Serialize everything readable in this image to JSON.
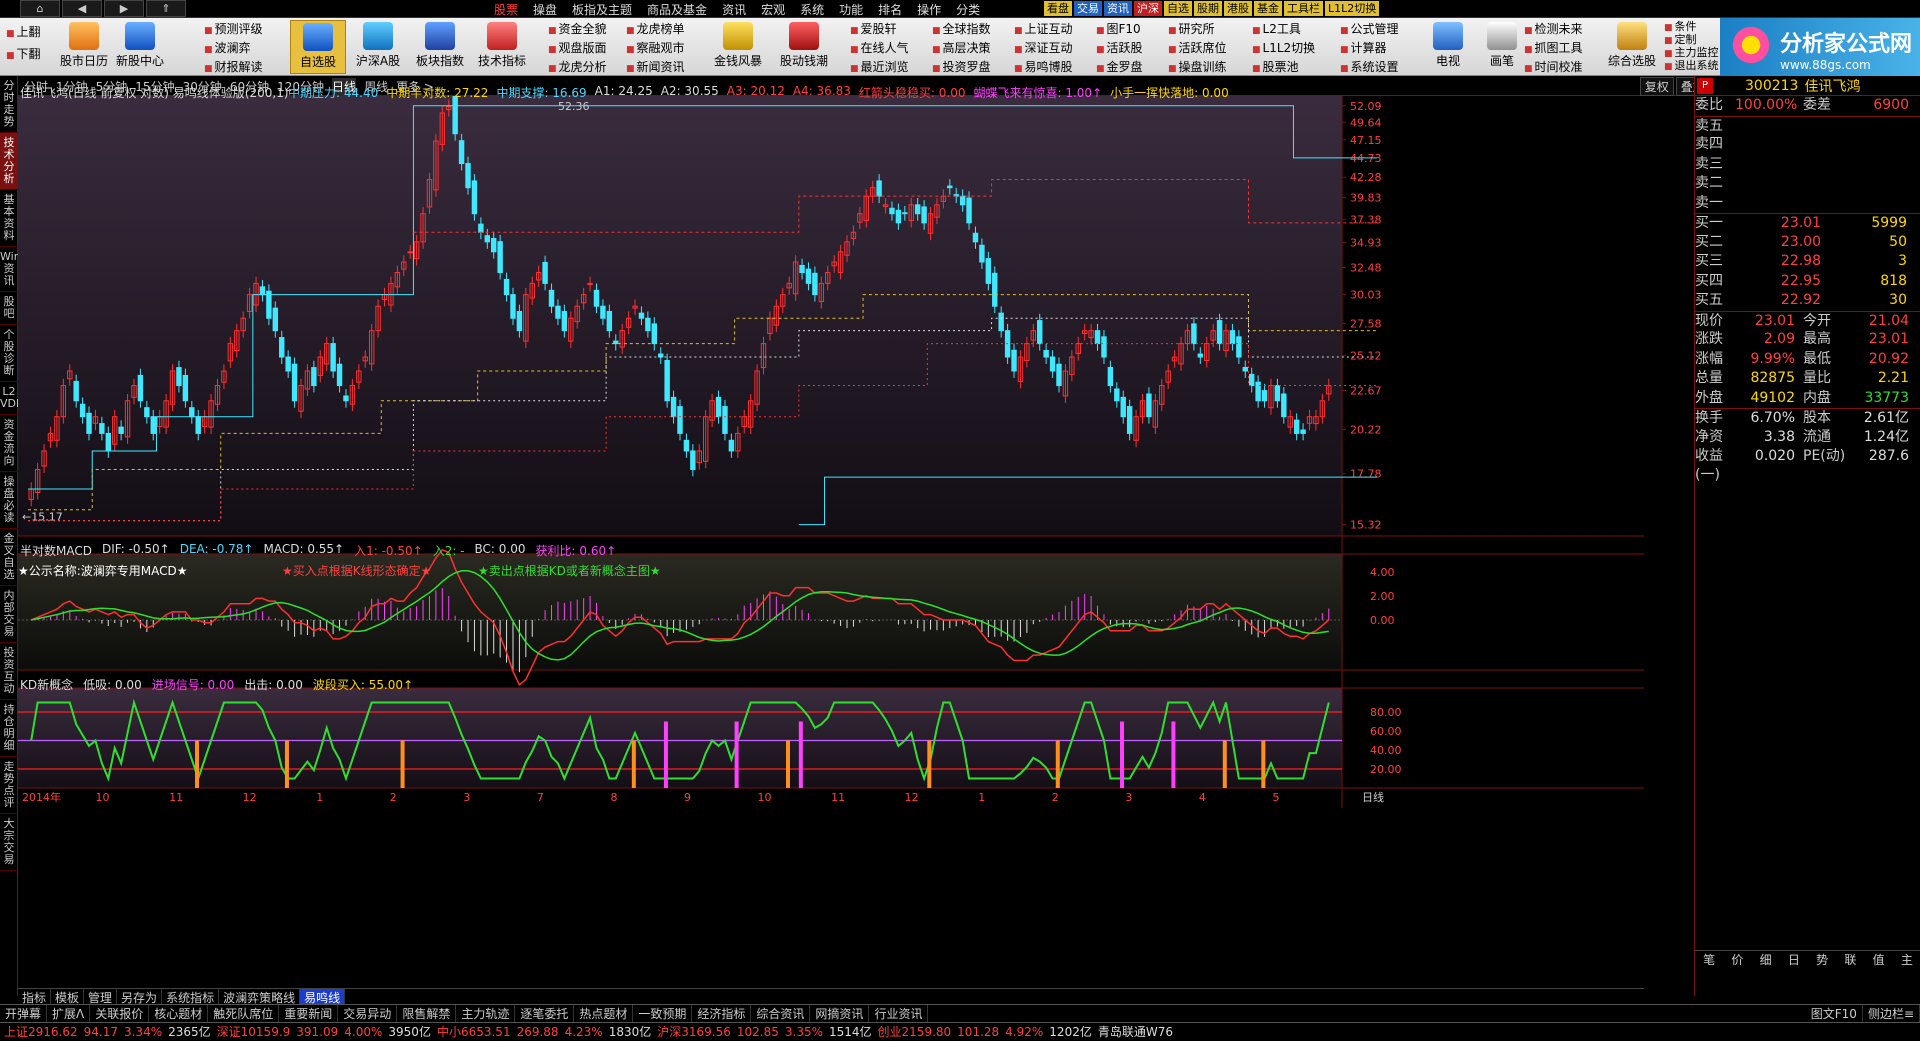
{
  "menu": {
    "nav": [
      "上",
      "上",
      "下",
      "下"
    ],
    "items": [
      "股票",
      "操盘",
      "板指及主题",
      "商品及基金",
      "资讯",
      "宏观",
      "系统",
      "功能",
      "排名",
      "操作",
      "分类"
    ],
    "tags": [
      "看盘",
      "交易",
      "资讯",
      "沪深",
      "自选",
      "股期",
      "港股",
      "基金",
      "工具栏",
      "L1L2切换"
    ]
  },
  "toolbar": {
    "buttons": [
      "股市日历",
      "新股中心",
      "自选股",
      "沪深A股",
      "板块指数",
      "技术指标",
      "金钱风暴",
      "股动钱潮",
      "电视",
      "画笔",
      "综合选股"
    ],
    "col1": [
      "上翻",
      "下翻"
    ],
    "col2": [
      "预测评级",
      "波澜弈",
      "财报解读"
    ],
    "col3": [
      "资金全貌",
      "观盘版面",
      "龙虎分析"
    ],
    "col4": [
      "龙虎榜单",
      "察融观市",
      "新闻资讯"
    ],
    "col5": [
      "爱股轩",
      "在线人气",
      "最近浏览"
    ],
    "col6": [
      "全球指数",
      "高层决策",
      "投资罗盘"
    ],
    "col7": [
      "上证互动",
      "深证互动",
      "易鸣博股"
    ],
    "col8": [
      "图F10",
      "活跃股",
      "金罗盘"
    ],
    "col9": [
      "研究所",
      "活跃席位",
      "操盘训练"
    ],
    "col10": [
      "L2工具",
      "L1L2切换",
      "股票池"
    ],
    "col11": [
      "公式管理",
      "计算器",
      "系统设置"
    ],
    "col12": [
      "检测未来",
      "抓图工具",
      "时间校准"
    ],
    "col13": [
      "条件",
      "定制",
      "主力监控",
      "退出系统"
    ],
    "logo": "分析家公式网",
    "logo_url": "www.88gs.com"
  },
  "periods": [
    "分时",
    "1分钟",
    "5分钟",
    "15分钟",
    "30分钟",
    "60分钟",
    "120分钟",
    "日线",
    "周线",
    "更多 >"
  ],
  "period_right": [
    "复权",
    "叠加",
    "画线",
    "F10",
    "标记",
    "+自选",
    "返回"
  ],
  "left_tabs": [
    "分时走势",
    "技术分析",
    "基本资料",
    "Wind资讯",
    "股吧",
    "个股诊断",
    "L2 VDE",
    "资金流向",
    "操盘必读",
    "金叉自选",
    "内部交易",
    "投资互动",
    "持仓明细",
    "走势点评",
    "大宗交易"
  ],
  "main": {
    "title": "佳讯飞鸿(日线 前复权 对数) 易鸣线体验版(200,1)",
    "ind": [
      {
        "t": "中期压力: 44.40",
        "c": "c"
      },
      {
        "t": "中期半对数: 27.22",
        "c": "y"
      },
      {
        "t": "中期支撑: 16.69",
        "c": "c"
      },
      {
        "t": "A1: 24.25",
        "c": "w"
      },
      {
        "t": "A2: 30.55",
        "c": "w"
      },
      {
        "t": "A3: 20.12",
        "c": "r"
      },
      {
        "t": "A4: 36.83",
        "c": "r"
      },
      {
        "t": "红箭头稳稳买: 0.00",
        "c": "r"
      },
      {
        "t": "蝴蝶飞来有惊喜: 1.00↑",
        "c": "m"
      },
      {
        "t": "小手一挥快落地: 0.00",
        "c": "y"
      }
    ],
    "yaxis": [
      "52.09",
      "49.64",
      "47.15",
      "44.73",
      "42.28",
      "39.83",
      "37.38",
      "34.93",
      "32.48",
      "30.03",
      "27.58",
      "25.12",
      "22.67",
      "20.22",
      "17.78",
      "15.32"
    ],
    "high_label": "52.36",
    "low_label": "←15.17"
  },
  "macd": {
    "header": [
      {
        "t": "半对数MACD",
        "c": "w"
      },
      {
        "t": "DIF: -0.50↑",
        "c": "w"
      },
      {
        "t": "DEA: -0.78↑",
        "c": "c"
      },
      {
        "t": "MACD: 0.55↑",
        "c": "w"
      },
      {
        "t": "入1: -0.50↑",
        "c": "r"
      },
      {
        "t": "入2: -",
        "c": "g"
      },
      {
        "t": "BC: 0.00",
        "c": "w"
      },
      {
        "t": "获利比: 0.60↑",
        "c": "m"
      }
    ],
    "caption1": "★公示名称:波澜弈专用MACD★",
    "caption2": "★买入点根据K线形态确定★",
    "caption3": "★卖出点根据KD或者新概念主图★",
    "yaxis": [
      "4.00",
      "2.00",
      "0.00"
    ]
  },
  "kd": {
    "header": [
      {
        "t": "KD新概念",
        "c": "w"
      },
      {
        "t": "低吸: 0.00",
        "c": "w"
      },
      {
        "t": "进场信号: 0.00",
        "c": "m"
      },
      {
        "t": "出击: 0.00",
        "c": "w"
      },
      {
        "t": "波段买入: 55.00↑",
        "c": "y"
      }
    ],
    "yaxis": [
      "80.00",
      "60.00",
      "40.00",
      "20.00"
    ]
  },
  "xaxis": [
    "2014年",
    "10",
    "11",
    "12",
    "1",
    "2",
    "3",
    "7",
    "8",
    "9",
    "10",
    "11",
    "12",
    "1",
    "2",
    "3",
    "4",
    "5"
  ],
  "xaxis_right": "日线",
  "subtabs": [
    "指标",
    "模板",
    "管理",
    "另存为",
    "系统指标",
    "波澜弈策略线",
    "易鸣线"
  ],
  "bottom_tabs": [
    "开弹幕",
    "扩展ᐱ",
    "关联报价",
    "核心题材",
    "触死队席位",
    "重要新闻",
    "交易异动",
    "限售解禁",
    "主力轨迹",
    "逐笔委托",
    "热点题材",
    "一致预期",
    "经济指标",
    "综合资讯",
    "网摘资讯",
    "行业资讯"
  ],
  "bottom_right": [
    "图文F10",
    "侧边栏≡"
  ],
  "right_panel": {
    "code": "300213",
    "name": "佳讯飞鸿",
    "ratio": [
      "委比",
      "100.00%",
      "委差",
      "6900"
    ],
    "sells": [
      "卖五",
      "卖四",
      "卖三",
      "卖二",
      "卖一"
    ],
    "buys": [
      [
        "买一",
        "23.01",
        "5999"
      ],
      [
        "买二",
        "23.00",
        "50"
      ],
      [
        "买三",
        "22.98",
        "3"
      ],
      [
        "买四",
        "22.95",
        "818"
      ],
      [
        "买五",
        "22.92",
        "30"
      ]
    ],
    "stats": [
      [
        "现价",
        "23.01",
        "今开",
        "21.04"
      ],
      [
        "涨跌",
        "2.09",
        "最高",
        "23.01"
      ],
      [
        "涨幅",
        "9.99%",
        "最低",
        "20.92"
      ],
      [
        "总量",
        "82875",
        "量比",
        "2.21"
      ],
      [
        "外盘",
        "49102",
        "内盘",
        "33773"
      ]
    ],
    "stats2": [
      [
        "换手",
        "6.70%",
        "股本",
        "2.61亿"
      ],
      [
        "净资",
        "3.38",
        "流通",
        "1.24亿"
      ],
      [
        "收益(一)",
        "0.020",
        "PE(动)",
        "287.6"
      ]
    ],
    "tabs": [
      "笔",
      "价",
      "细",
      "日",
      "势",
      "联",
      "值",
      "主"
    ]
  },
  "status": [
    {
      "t": "上证2916.62",
      "c": "r"
    },
    {
      "t": "94.17",
      "c": "r"
    },
    {
      "t": "3.34%",
      "c": "r"
    },
    {
      "t": "2365亿",
      "c": "w"
    },
    {
      "t": "深证10159.9",
      "c": "r"
    },
    {
      "t": "391.09",
      "c": "r"
    },
    {
      "t": "4.00%",
      "c": "r"
    },
    {
      "t": "3950亿",
      "c": "w"
    },
    {
      "t": "中小6653.51",
      "c": "r"
    },
    {
      "t": "269.88",
      "c": "r"
    },
    {
      "t": "4.23%",
      "c": "r"
    },
    {
      "t": "1830亿",
      "c": "w"
    },
    {
      "t": "沪深3169.56",
      "c": "r"
    },
    {
      "t": "102.85",
      "c": "r"
    },
    {
      "t": "3.35%",
      "c": "r"
    },
    {
      "t": "1514亿",
      "c": "w"
    },
    {
      "t": "创业2159.80",
      "c": "r"
    },
    {
      "t": "101.28",
      "c": "r"
    },
    {
      "t": "4.92%",
      "c": "r"
    },
    {
      "t": "1202亿",
      "c": "w"
    },
    {
      "t": "青岛联通W76",
      "c": "w"
    }
  ],
  "chart_data": {
    "type": "candlestick",
    "ylim": [
      15.17,
      52.36
    ],
    "closes": [
      17,
      18,
      19,
      20,
      21,
      23,
      24,
      22,
      21,
      20,
      21,
      20,
      19,
      21,
      20,
      22,
      23,
      22,
      21,
      20,
      21,
      22,
      24,
      23,
      22,
      21,
      20,
      21,
      22,
      23,
      24,
      26,
      27,
      28,
      30,
      31,
      30,
      28,
      27,
      25,
      24,
      22,
      23,
      24,
      23,
      25,
      26,
      24,
      23,
      22,
      23,
      24,
      25,
      27,
      29,
      30,
      31,
      32,
      33,
      34,
      35,
      38,
      42,
      47,
      51,
      52,
      48,
      44,
      41,
      38,
      36,
      35,
      34,
      32,
      30,
      28,
      27,
      30,
      31,
      32,
      31,
      29,
      28,
      27,
      28,
      29,
      30,
      31,
      29,
      28,
      27,
      26,
      27,
      28,
      29,
      28,
      27,
      26,
      25,
      22,
      21,
      20,
      19,
      18,
      19,
      21,
      22,
      21,
      20,
      19,
      20,
      21,
      22,
      24,
      26,
      28,
      29,
      30,
      31,
      33,
      32,
      31,
      30,
      31,
      32,
      33,
      34,
      35,
      36,
      38,
      40,
      41,
      40,
      39,
      38,
      37,
      38,
      39,
      38,
      37,
      38,
      39,
      40,
      41,
      40,
      39,
      37,
      35,
      33,
      31,
      29,
      27,
      25,
      24,
      25,
      26,
      27,
      26,
      25,
      24,
      23,
      24,
      25,
      26,
      27,
      27,
      26,
      25,
      23,
      22,
      21,
      20,
      21,
      22,
      21,
      22,
      23,
      24,
      25,
      26,
      27,
      26,
      25,
      26,
      27,
      26,
      27,
      26,
      25,
      24,
      23,
      22,
      22,
      23,
      22,
      21,
      21,
      20,
      20,
      21,
      21,
      22,
      23
    ]
  }
}
